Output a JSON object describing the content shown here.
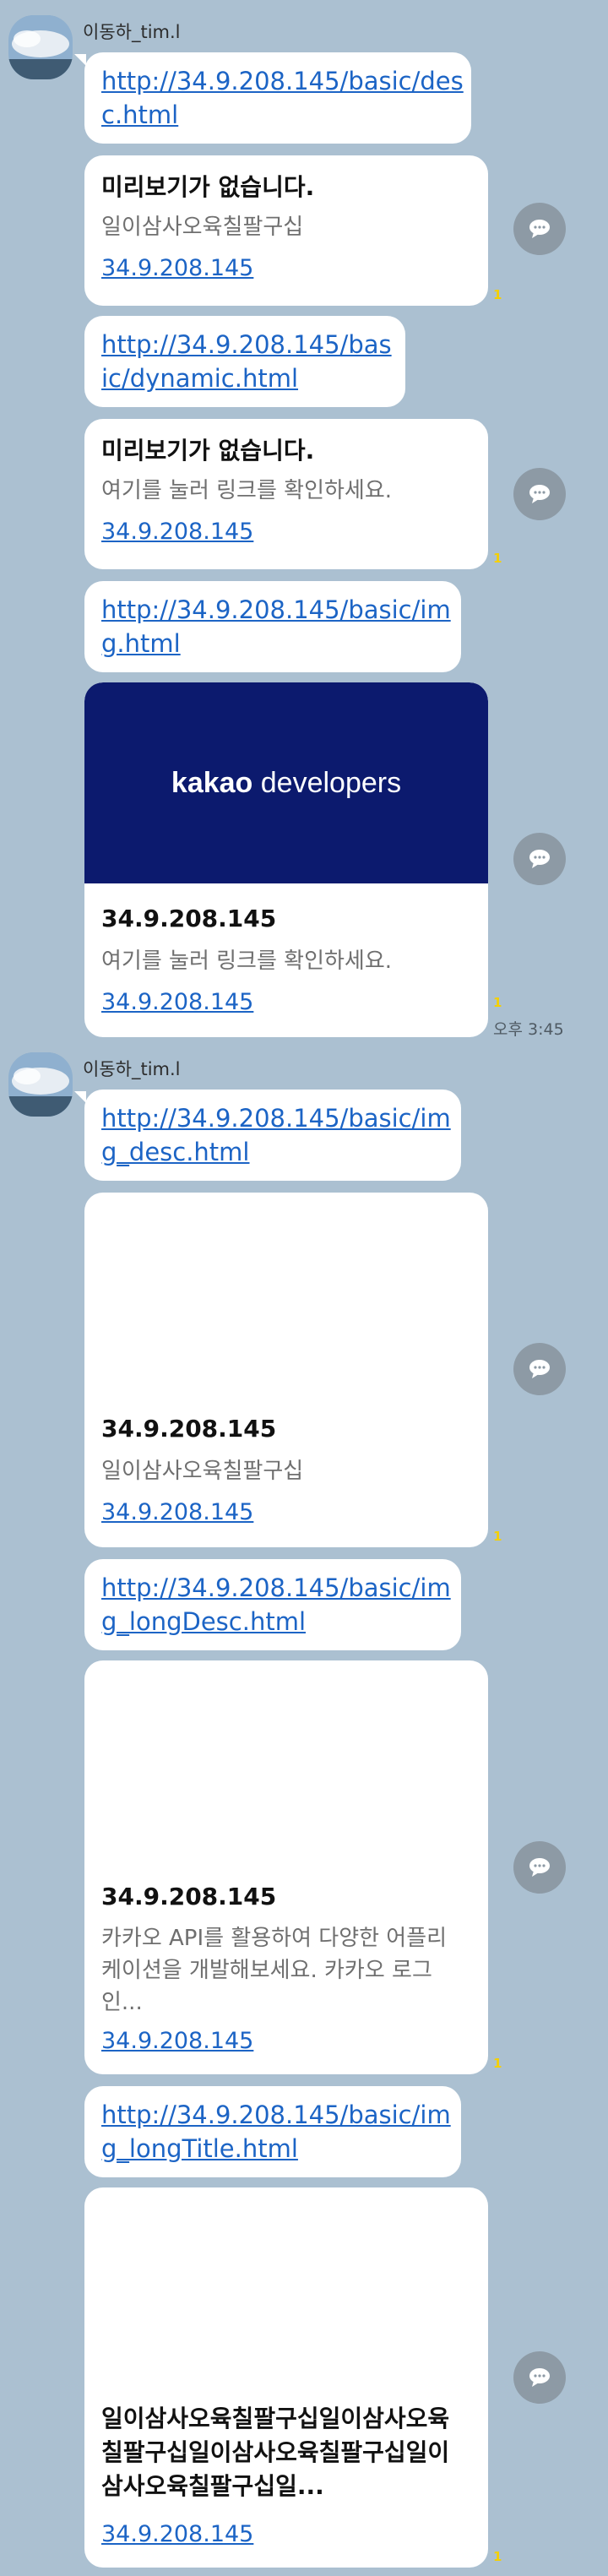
{
  "chat": {
    "sender": "이동하_tim.l",
    "time": "오후 3:45",
    "unread": "1",
    "share_icon": "speech-bubble-icon"
  },
  "messages": {
    "m1": {
      "link": "http://34.9.208.145/basic/desc.html"
    },
    "c1": {
      "title": "미리보기가 없습니다.",
      "desc": "일이삼사오육칠팔구십",
      "url": "34.9.208.145"
    },
    "m2": {
      "link": "http://34.9.208.145/basic/dynamic.html"
    },
    "c2": {
      "title": "미리보기가 없습니다.",
      "desc": "여기를 눌러 링크를 확인하세요.",
      "url": "34.9.208.145"
    },
    "m3": {
      "link": "http://34.9.208.145/basic/img.html"
    },
    "c3": {
      "banner_brand": "kakao",
      "banner_rest": " developers",
      "banner_color": "#0c1a6e",
      "title": "34.9.208.145",
      "desc": "여기를 눌러 링크를 확인하세요.",
      "url": "34.9.208.145"
    },
    "m4": {
      "link": "http://34.9.208.145/basic/img_desc.html"
    },
    "c4": {
      "title": "34.9.208.145",
      "desc": "일이삼사오육칠팔구십",
      "url": "34.9.208.145"
    },
    "m5": {
      "link": "http://34.9.208.145/basic/img_longDesc.html"
    },
    "c5": {
      "title": "34.9.208.145",
      "desc": "카카오 API를 활용하여 다양한 어플리케이션을 개발해보세요. 카카오 로그인...",
      "url": "34.9.208.145"
    },
    "m6": {
      "link": "http://34.9.208.145/basic/img_longTitle.html"
    },
    "c6": {
      "title": "일이삼사오육칠팔구십일이삼사오육칠팔구십일이삼사오육칠팔구십일이삼사오육칠팔구십일...",
      "url": "34.9.208.145"
    }
  }
}
